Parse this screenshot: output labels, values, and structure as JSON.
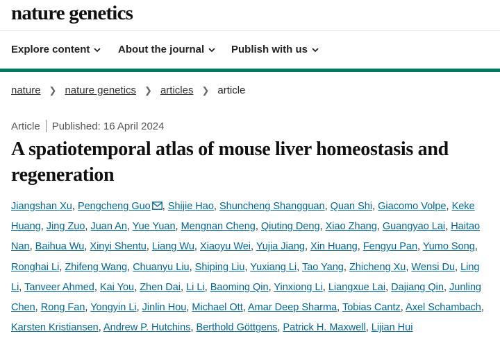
{
  "brand": {
    "logo": "nature genetics"
  },
  "nav": [
    {
      "label": "Explore content"
    },
    {
      "label": "About the journal"
    },
    {
      "label": "Publish with us"
    }
  ],
  "breadcrumb": [
    {
      "label": "nature",
      "link": true
    },
    {
      "label": "nature genetics",
      "link": true
    },
    {
      "label": "articles",
      "link": true
    },
    {
      "label": "article",
      "link": false
    }
  ],
  "article": {
    "type": "Article",
    "published": "Published: 16 April 2024",
    "title": "A spatiotemporal atlas of mouse liver homeostasis and regeneration",
    "authors": [
      "Jiangshan Xu",
      "Pengcheng Guo",
      "Shijie Hao",
      "Shuncheng Shangguan",
      "Quan Shi",
      "Giacomo Volpe",
      "Keke Huang",
      "Jing Zuo",
      "Juan An",
      "Yue Yuan",
      "Mengnan Cheng",
      "Qiuting Deng",
      "Xiao Zhang",
      "Guangyao Lai",
      "Haitao Nan",
      "Baihua Wu",
      "Xinyi Shentu",
      "Liang Wu",
      "Xiaoyu Wei",
      "Yujia Jiang",
      "Xin Huang",
      "Fengyu Pan",
      "Yumo Song",
      "Ronghai Li",
      "Zhifeng Wang",
      "Chuanyu Liu",
      "Shiping Liu",
      "Yuxiang Li",
      "Tao Yang",
      "Zhicheng Xu",
      "Wensi Du",
      "Ling Li",
      "Tanveer Ahmed",
      "Kai You",
      "Zhen Dai",
      "Li Li",
      "Baoming Qin",
      "Yinxiong Li",
      "Liangxue Lai",
      "Dajiang Qin",
      "Junling Chen",
      "Rong Fan",
      "Yongyin Li",
      "Jinlin Hou",
      "Michael Ott",
      "Amar Deep Sharma",
      "Tobias Cantz",
      "Axel Schambach",
      "Karsten Kristiansen",
      "Andrew P. Hutchins",
      "Berthold Göttgens",
      "Patrick H. Maxwell",
      "Lijian Hui"
    ],
    "corresponding_author_index": 1
  },
  "colors": {
    "accent": "#007a5c",
    "link": "#006699"
  }
}
